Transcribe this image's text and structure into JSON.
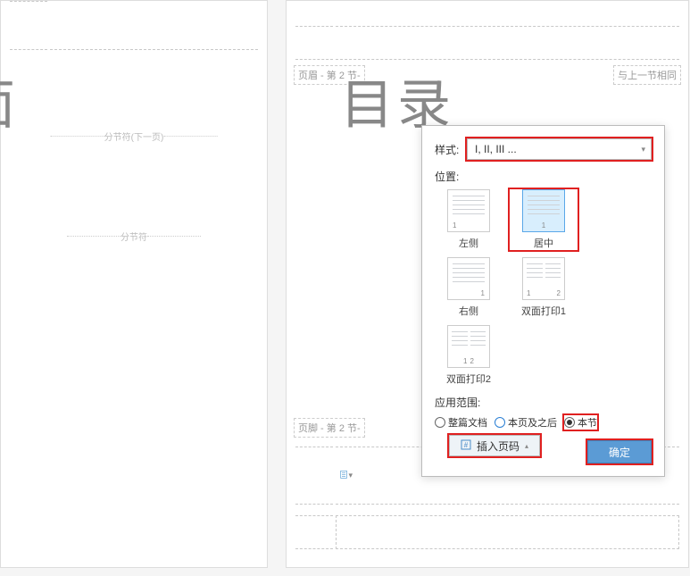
{
  "left_page": {
    "title_fragment": "面",
    "section_break_text": "分节符(下一页)",
    "section_break_text2": "分节符"
  },
  "right_page": {
    "header_label": "页眉 - 第 2 节-",
    "same_as_prev": "与上一节相同",
    "title": "目录",
    "footer_label": "页脚 - 第 2 节-"
  },
  "popup": {
    "format_label": "样式:",
    "format_value": "I, II, III ...",
    "position_label": "位置:",
    "positions": {
      "left": "左侧",
      "center": "居中",
      "right": "右侧",
      "duplex1": "双面打印1",
      "duplex2": "双面打印2"
    },
    "scope_label": "应用范围:",
    "scopes": {
      "whole": "整篇文档",
      "from_here": "本页及之后",
      "this_section": "本节"
    },
    "ok": "确定"
  },
  "insert_page_number": "插入页码"
}
